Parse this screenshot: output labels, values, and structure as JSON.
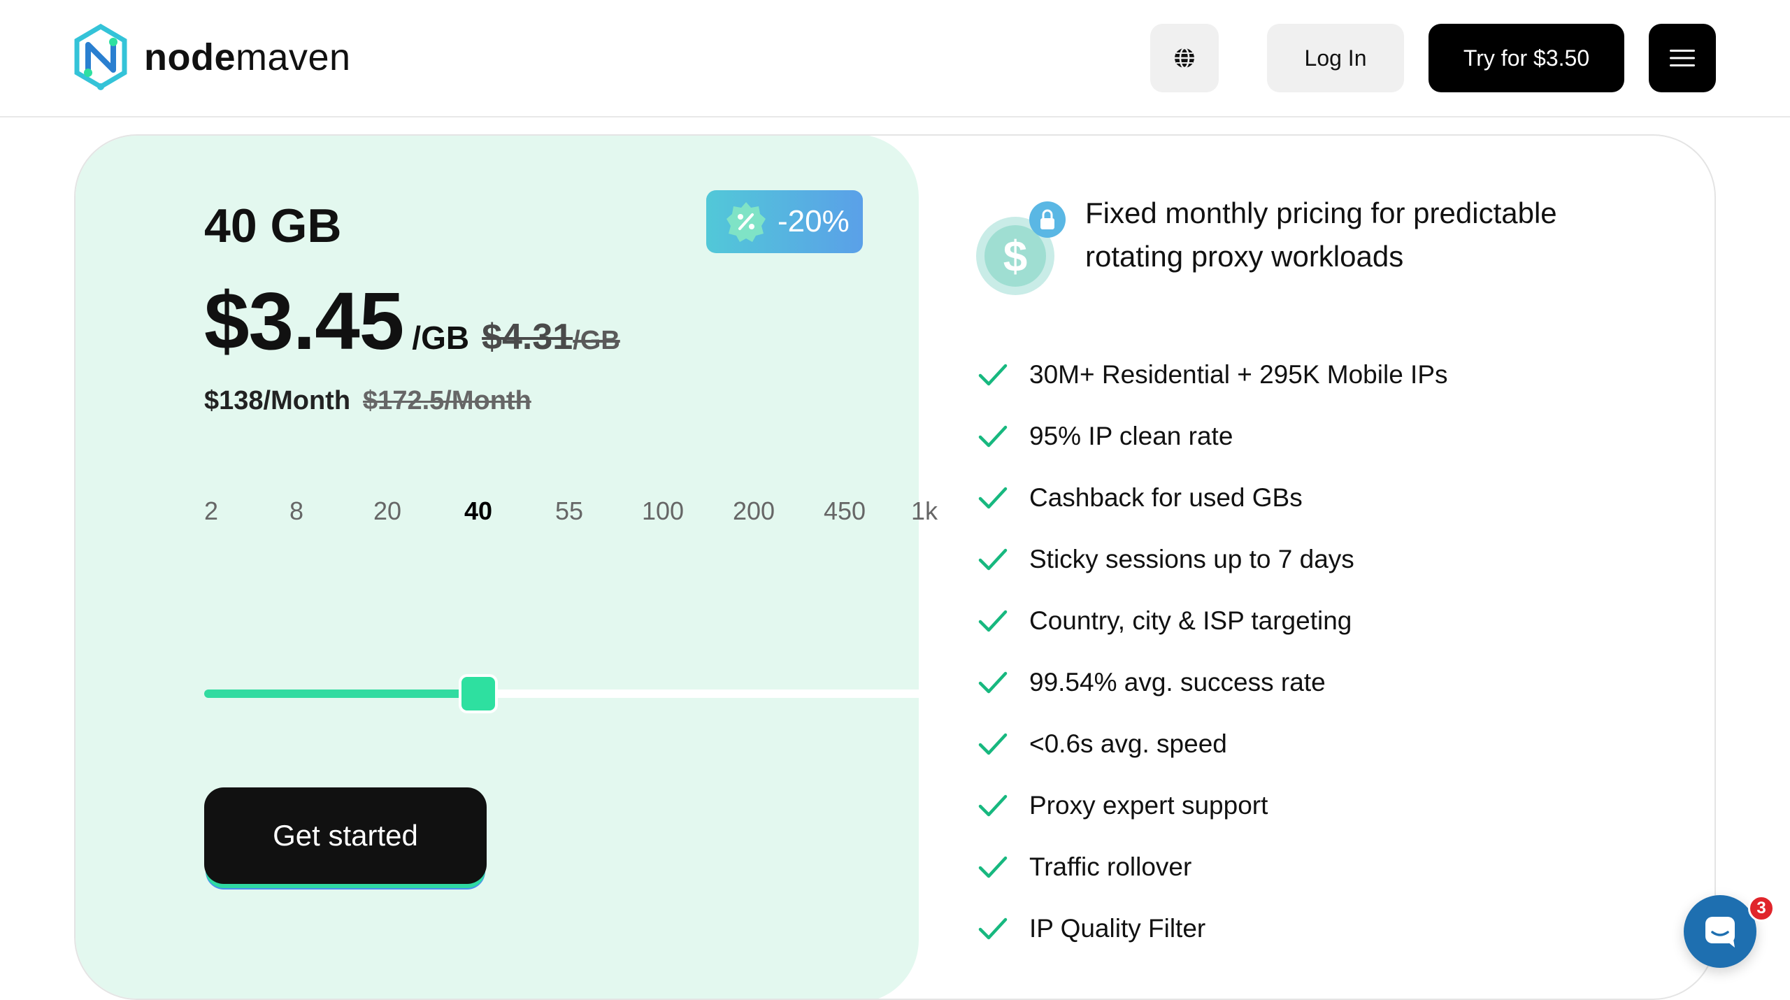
{
  "brand": {
    "name_bold": "node",
    "name_light": "maven"
  },
  "header": {
    "login_label": "Log In",
    "try_label": "Try for $3.50",
    "language_icon": "globe-icon",
    "menu_icon": "hamburger-menu-icon"
  },
  "plan": {
    "size": "40 GB",
    "discount": "-20%",
    "price": "$3.45",
    "price_unit": "/GB",
    "old_price": "$4.31",
    "old_price_unit": "/GB",
    "monthly": "$138/Month",
    "old_monthly": "$172.5/Month",
    "cta_label": "Get started"
  },
  "slider": {
    "options": [
      "2",
      "8",
      "20",
      "40",
      "55",
      "100",
      "200",
      "450",
      "1k"
    ],
    "selected_index": 3,
    "selected_value": "40"
  },
  "headline": "Fixed monthly pricing for predictable rotating proxy workloads",
  "features": [
    "30M+ Residential + 295K Mobile IPs",
    "95% IP clean rate",
    "Cashback for used GBs",
    "Sticky sessions up to 7 days",
    "Country, city & ISP targeting",
    "99.54% avg. success rate",
    "<0.6s avg. speed",
    "Proxy expert support",
    "Traffic rollover",
    "IP Quality Filter"
  ],
  "chat": {
    "badge_count": "3",
    "icon": "chat-icon"
  },
  "colors": {
    "accent_green": "#2ee0a0",
    "panel_bg": "#e3f8ef",
    "check_green": "#17b87f",
    "dark": "#111111"
  }
}
